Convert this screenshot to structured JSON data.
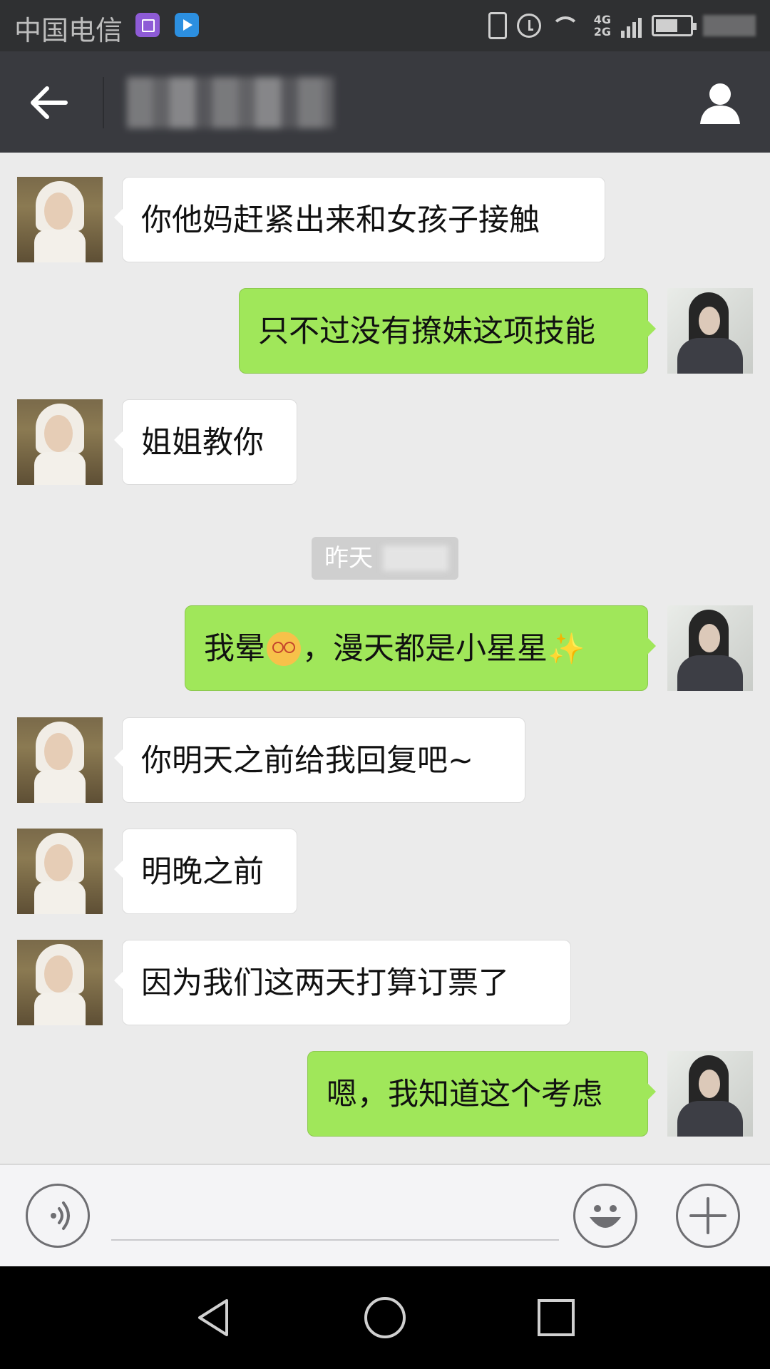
{
  "status_bar": {
    "carrier": "中国电信",
    "network_label_top": "4G",
    "network_label_bottom": "2G"
  },
  "chat": {
    "title": ""
  },
  "messages": [
    {
      "side": "in",
      "text": "你他妈赶紧出来和女孩子接触"
    },
    {
      "side": "out",
      "text": "只不过没有撩妹这项技能"
    },
    {
      "side": "in",
      "text": "姐姐教你"
    },
    {
      "side": "out",
      "text_before": "我晕",
      "text_after": "，漫天都是小星星",
      "emoji_1": "dizzy-face-icon",
      "emoji_2": "sparkles-icon"
    },
    {
      "side": "in",
      "text": "你明天之前给我回复吧~"
    },
    {
      "side": "in",
      "text": "明晚之前"
    },
    {
      "side": "in",
      "text": "因为我们这两天打算订票了"
    },
    {
      "side": "out",
      "text": "嗯，我知道这个考虑"
    }
  ],
  "timestamp": {
    "label": "昨天"
  },
  "input": {
    "value": "",
    "placeholder": ""
  },
  "colors": {
    "outgoing_bubble": "#a0e75a",
    "incoming_bubble": "#ffffff",
    "chat_background": "#ebebeb",
    "header": "#393a3f",
    "status_bar": "#2f3032"
  }
}
